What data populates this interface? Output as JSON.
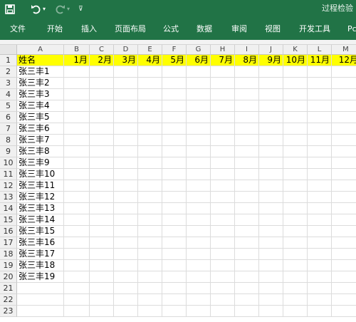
{
  "window": {
    "doc_title": "过程检验"
  },
  "quick_access": {
    "save_icon": "save-icon",
    "undo_icon": "undo-icon",
    "redo_icon": "redo-icon",
    "customize_glyph": "⊽"
  },
  "ribbon": {
    "tabs": [
      "文件",
      "开始",
      "插入",
      "页面布局",
      "公式",
      "数据",
      "审阅",
      "视图",
      "开发工具",
      "Pc"
    ]
  },
  "columns": [
    "A",
    "B",
    "C",
    "D",
    "E",
    "F",
    "G",
    "H",
    "I",
    "J",
    "K",
    "L",
    "M"
  ],
  "rows": [
    "1",
    "2",
    "3",
    "4",
    "5",
    "6",
    "7",
    "8",
    "9",
    "10",
    "11",
    "12",
    "13",
    "14",
    "15",
    "16",
    "17",
    "18",
    "19",
    "20",
    "21",
    "22",
    "23"
  ],
  "header_row": {
    "name": "姓名",
    "months": [
      "1月",
      "2月",
      "3月",
      "4月",
      "5月",
      "6月",
      "7月",
      "8月",
      "9月",
      "10月",
      "11月",
      "12月"
    ]
  },
  "names": [
    "张三丰1",
    "张三丰2",
    "张三丰3",
    "张三丰4",
    "张三丰5",
    "张三丰6",
    "张三丰7",
    "张三丰8",
    "张三丰9",
    "张三丰10",
    "张三丰11",
    "张三丰12",
    "张三丰13",
    "张三丰14",
    "张三丰15",
    "张三丰16",
    "张三丰17",
    "张三丰18",
    "张三丰19"
  ],
  "colors": {
    "ribbon": "#217346",
    "highlight": "#ffff00"
  }
}
